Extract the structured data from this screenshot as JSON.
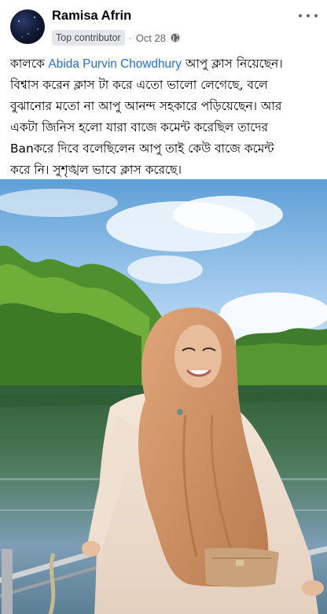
{
  "post": {
    "author": "Ramisa Afrin",
    "badge": "Top contributor",
    "separator": "·",
    "date": "Oct 28",
    "text_parts": {
      "line1_prefix": "কালকে ",
      "mention": "Abida Purvin Chowdhury",
      "line1_suffix": "  আপু ক্লাস নিয়েছেন।",
      "line2": "বিশ্বাস করেন ক্লাস টা করে এতো ভালো লেগেছে, বলে",
      "line3": "বুঝানোর মতো না আপু আনন্দ সহকারে পড়িয়েছেন। আর",
      "line4": "একটা জিনিস হলো যারা বাজে কমেন্ট করেছিল তাদের",
      "line5": "Banকরে দিবে বলেছিলেন আপু তাই কেউ বাজে কমেন্ট",
      "line6": "করে নি। সুশৃঙ্খল ভাবে ক্লাস করেছে।"
    }
  },
  "icons": {
    "more": "more-horizontal-icon",
    "privacy": "globe-icon"
  },
  "colors": {
    "mention": "#216fdb",
    "badge_bg": "#e4e6eb",
    "meta": "#65676b"
  }
}
